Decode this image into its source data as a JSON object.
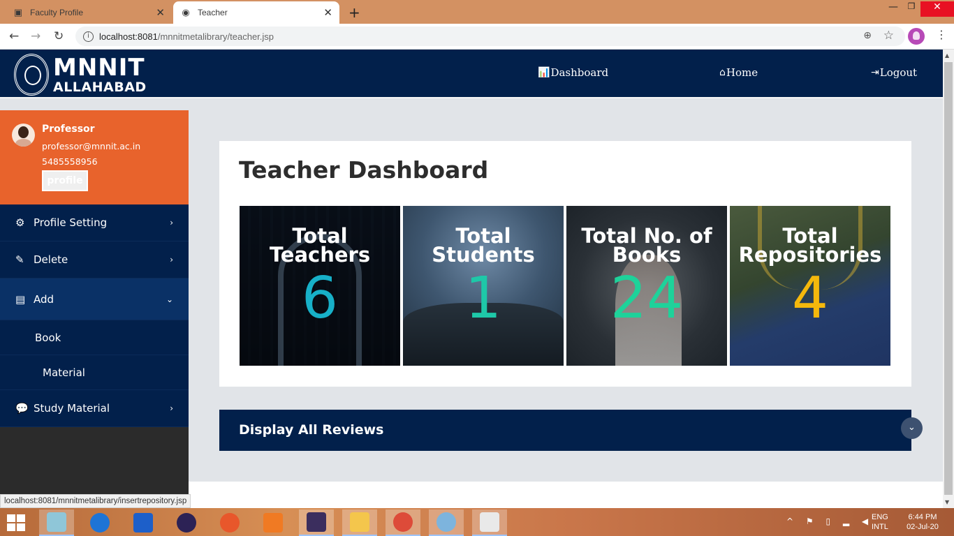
{
  "browser": {
    "tabs": [
      {
        "title": "Faculty Profile",
        "close": "✕",
        "active": false
      },
      {
        "title": "Teacher",
        "close": "✕",
        "active": true
      }
    ],
    "new_tab": "+",
    "url_host": "localhost:8081",
    "url_path": "/mnnitmetalibrary/teacher.jsp"
  },
  "navbar": {
    "logo_line1": "MNNIT",
    "logo_line2": "ALLAHABAD",
    "links": [
      {
        "icon": "bar-chart-icon",
        "label": "Dashboard"
      },
      {
        "icon": "home-icon",
        "label": "Home"
      },
      {
        "icon": "logout-icon",
        "label": "Logout"
      }
    ]
  },
  "profile": {
    "name": "Professor",
    "email": "professor@mnnit.ac.in",
    "phone": "5485558956",
    "button": "profile"
  },
  "sidebar": {
    "items": [
      {
        "icon": "gears-icon",
        "label": "Profile Setting",
        "chevron": "›"
      },
      {
        "icon": "pencil-icon",
        "label": "Delete",
        "chevron": "›"
      },
      {
        "icon": "book-icon",
        "label": "Add",
        "chevron": "⌄"
      },
      {
        "icon": "chat-icon",
        "label": "Study Material",
        "chevron": "›"
      }
    ],
    "add_subitems": [
      "Book",
      "Material"
    ]
  },
  "dashboard": {
    "title": "Teacher Dashboard",
    "tiles": [
      {
        "label": "Total Teachers",
        "value": "6",
        "color": "#17b0c8"
      },
      {
        "label": "Total Students",
        "value": "1",
        "color": "#1ec8a8"
      },
      {
        "label": "Total No. of Books",
        "value": "24",
        "color": "#1ed29a"
      },
      {
        "label": "Total Repositories",
        "value": "4",
        "color": "#f5b80c"
      }
    ]
  },
  "reviews": {
    "title": "Display All Reviews"
  },
  "status_url": "localhost:8081/mnnitmetalibrary/insertrepository.jsp",
  "taskbar": {
    "lang_1": "ENG",
    "lang_2": "INTL",
    "time": "6:44 PM",
    "date": "02-Jul-20"
  },
  "colors": {
    "navbar": "#02204b",
    "profile_bg": "#e8632c",
    "content_bg": "#e1e4e8"
  }
}
